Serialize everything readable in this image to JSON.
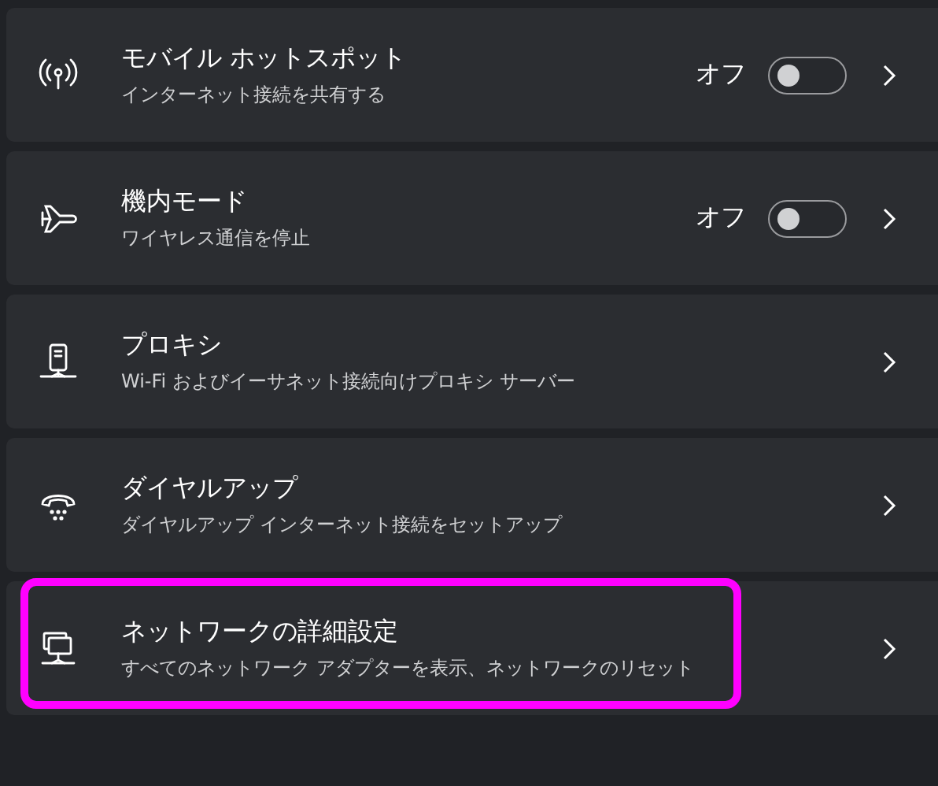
{
  "items": [
    {
      "title": "モバイル ホットスポット",
      "subtitle": "インターネット接続を共有する",
      "toggle": {
        "label": "オフ",
        "on": false
      },
      "highlighted": false
    },
    {
      "title": "機内モード",
      "subtitle": "ワイヤレス通信を停止",
      "toggle": {
        "label": "オフ",
        "on": false
      },
      "highlighted": false
    },
    {
      "title": "プロキシ",
      "subtitle": "Wi-Fi およびイーサネット接続向けプロキシ サーバー",
      "highlighted": false
    },
    {
      "title": "ダイヤルアップ",
      "subtitle": "ダイヤルアップ インターネット接続をセットアップ",
      "highlighted": false
    },
    {
      "title": "ネットワークの詳細設定",
      "subtitle": "すべてのネットワーク アダプターを表示、ネットワークのリセット",
      "highlighted": true
    }
  ]
}
